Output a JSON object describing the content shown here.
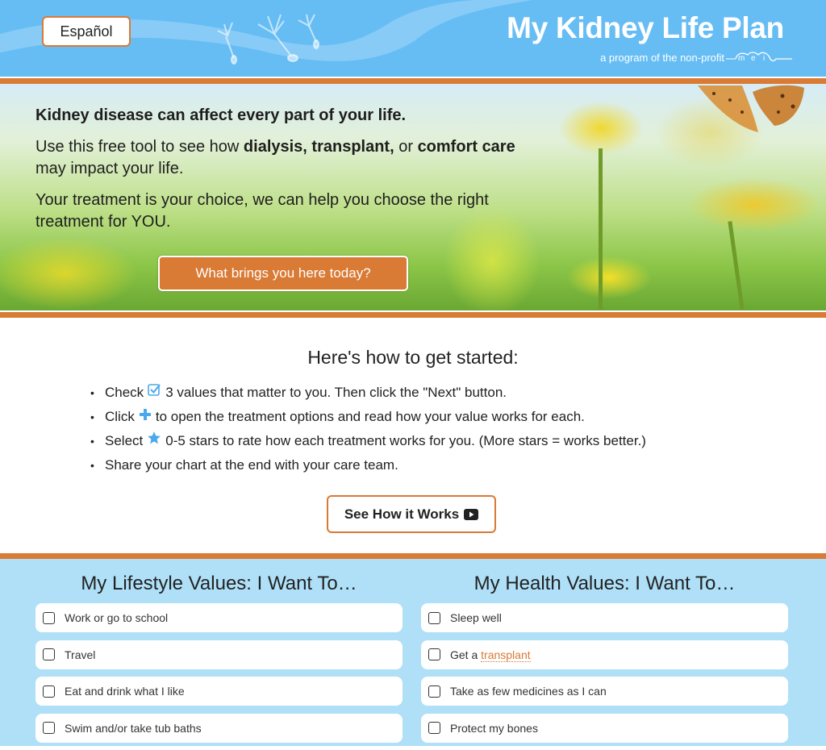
{
  "header": {
    "language_button": "Español",
    "title": "My Kidney Life Plan",
    "subtitle": "a program of the non-profit",
    "org_logo": "mei"
  },
  "hero": {
    "lead": "Kidney disease can affect every part of your life.",
    "para1_prefix": "Use this free tool to see how ",
    "para1_bold1": "dialysis, transplant,",
    "para1_mid": " or ",
    "para1_bold2": "comfort care",
    "para1_suffix": " may impact your life.",
    "para2": "Your treatment is your choice, we can help you choose the right treatment for YOU.",
    "cta_button": "What brings you here today?"
  },
  "howto": {
    "title": "Here's how to get started:",
    "steps": [
      {
        "before": "Check",
        "icon": "checkbox-icon",
        "after": "3 values that matter to you. Then click the \"Next\" button."
      },
      {
        "before": "Click",
        "icon": "plus-icon",
        "after": "to open the treatment options and read how your value works for each."
      },
      {
        "before": "Select",
        "icon": "star-icon",
        "after": "0-5 stars to rate how each treatment works for you. (More stars = works better.)"
      },
      {
        "before": "Share your chart at the end with your care team.",
        "icon": "",
        "after": ""
      }
    ],
    "video_button": "See How it Works"
  },
  "values": {
    "lifestyle": {
      "title": "My Lifestyle Values: I Want To…",
      "items": [
        {
          "label": "Work or go to school",
          "checked": false
        },
        {
          "label": "Travel",
          "checked": false
        },
        {
          "label": "Eat and drink what I like",
          "checked": false
        },
        {
          "label": "Swim and/or take tub baths",
          "checked": false
        }
      ]
    },
    "health": {
      "title": "My Health Values: I Want To…",
      "items": [
        {
          "label": "Sleep well",
          "checked": false
        },
        {
          "label": "Get a ",
          "link": "transplant",
          "checked": false
        },
        {
          "label": "Take as few medicines as I can",
          "checked": false
        },
        {
          "label": "Protect my bones",
          "checked": false
        }
      ]
    }
  },
  "colors": {
    "header_blue": "#66bdf4",
    "accent_orange": "#d97a35",
    "values_bg": "#afe0f8",
    "icon_blue": "#4aa8ec"
  }
}
